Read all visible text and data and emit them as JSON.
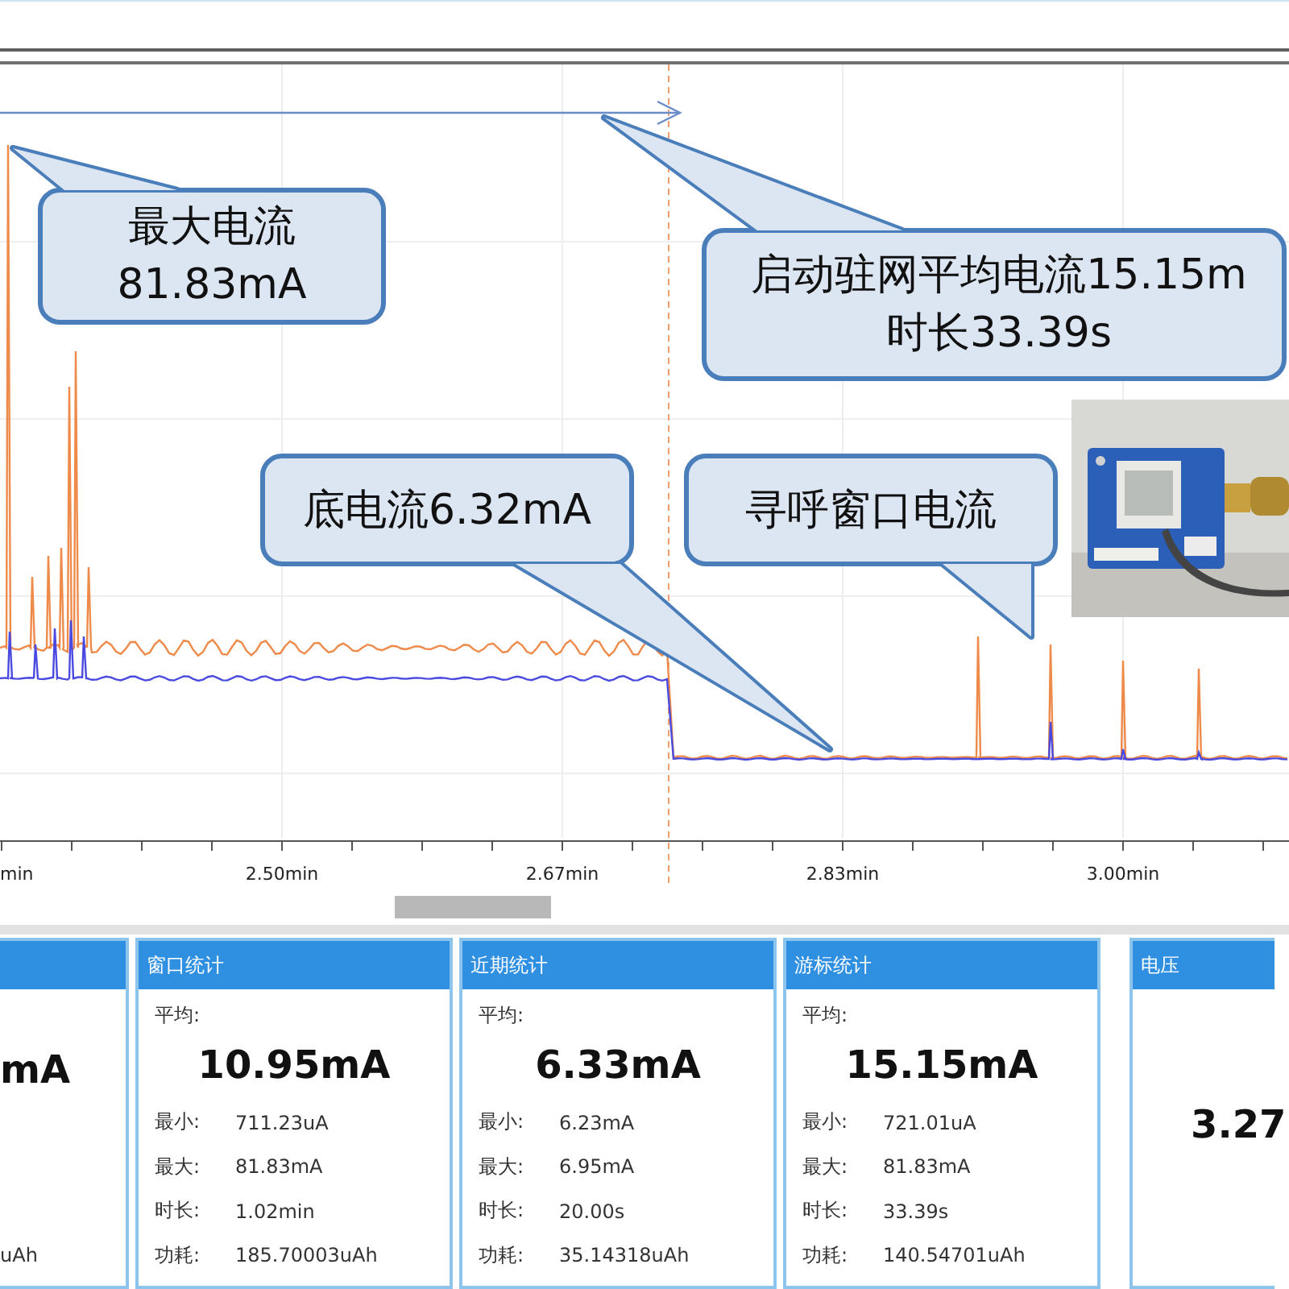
{
  "chart": {
    "x_axis_labels": [
      "min",
      "2.50min",
      "2.67min",
      "2.83min",
      "3.00min"
    ],
    "callouts": [
      {
        "lines": [
          "最大电流",
          "81.83mA"
        ]
      },
      {
        "lines": [
          "启动驻网平均电流15.15m",
          "时长33.39s"
        ]
      },
      {
        "lines": [
          "底电流6.32mA"
        ]
      },
      {
        "lines": [
          "寻呼窗口电流"
        ]
      }
    ]
  },
  "panels": [
    {
      "kind": "cut",
      "value": "mA",
      "energy": "uAh"
    },
    {
      "kind": "stats",
      "title": "窗口统计",
      "avg_label": "平均:",
      "value": "10.95mA",
      "rows": [
        {
          "label": "最小:",
          "value": "711.23uA"
        },
        {
          "label": "最大:",
          "value": "81.83mA"
        },
        {
          "label": "时长:",
          "value": "1.02min"
        },
        {
          "label": "功耗:",
          "value": "185.70003uAh"
        }
      ]
    },
    {
      "kind": "stats",
      "title": "近期统计",
      "avg_label": "平均:",
      "value": "6.33mA",
      "rows": [
        {
          "label": "最小:",
          "value": "6.23mA"
        },
        {
          "label": "最大:",
          "value": "6.95mA"
        },
        {
          "label": "时长:",
          "value": "20.00s"
        },
        {
          "label": "功耗:",
          "value": "35.14318uAh"
        }
      ]
    },
    {
      "kind": "stats",
      "title": "游标统计",
      "avg_label": "平均:",
      "value": "15.15mA",
      "rows": [
        {
          "label": "最小:",
          "value": "721.01uA"
        },
        {
          "label": "最大:",
          "value": "81.83mA"
        },
        {
          "label": "时长:",
          "value": "33.39s"
        },
        {
          "label": "功耗:",
          "value": "140.54701uAh"
        }
      ]
    },
    {
      "kind": "voltage",
      "title": "电压",
      "value": "3.27"
    }
  ]
}
